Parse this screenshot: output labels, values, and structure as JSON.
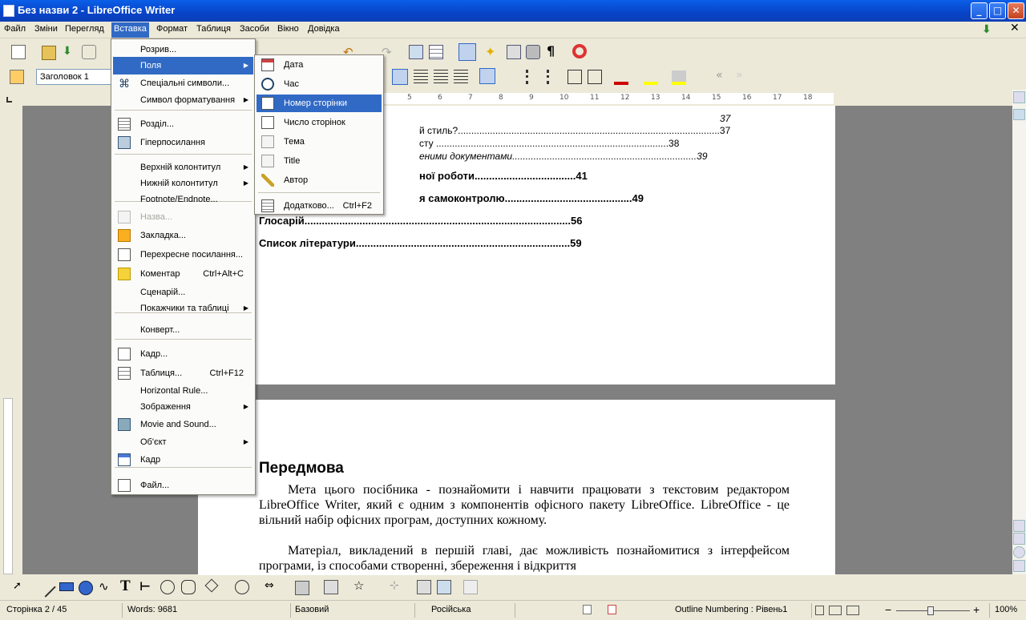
{
  "window": {
    "title": "Без назви 2 - LibreOffice Writer"
  },
  "menubar": {
    "items": [
      "Файл",
      "Зміни",
      "Перегляд",
      "Вставка",
      "Формат",
      "Таблиця",
      "Засоби",
      "Вікно",
      "Довідка"
    ],
    "active": "Вставка"
  },
  "toolbar": {
    "paragraph_style": "Заголовок 1"
  },
  "ruler": {
    "marks": [
      "5",
      "6",
      "7",
      "8",
      "9",
      "10",
      "11",
      "12",
      "13",
      "14",
      "15",
      "16",
      "17",
      "18"
    ]
  },
  "document": {
    "toc_lines": [
      {
        "text": "37",
        "style": "italic"
      },
      {
        "text": "й стиль?..................................................................................................37",
        "style": "normal"
      },
      {
        "text": "сту .......................................................................................38",
        "style": "normal"
      },
      {
        "text": "еними документами.....................................................................39",
        "style": "italic"
      },
      {
        "text": "ної роботи...................................41",
        "style": "bold"
      },
      {
        "text": "я самоконтролю............................................49",
        "style": "bold"
      },
      {
        "text": "Глосарій............................................................................................56",
        "style": "bold"
      },
      {
        "text": "Список літератури..........................................................................59",
        "style": "bold"
      }
    ],
    "heading": "Передмова",
    "paragraph1": "Мета цього посібника - познайомити і навчити працювати з текстовим редактором LibreOffice Writer, який є одним з компонентів офісного пакету LibreOffice. LibreOffice - це вільний набір офісних програм, доступних кожному.",
    "paragraph2": "Матеріал, викладений в першій главі, дає можливість познайомитися з інтерфейсом програми, із способами створенні, збереження і відкриття"
  },
  "insert_menu": {
    "items": [
      {
        "label": "Розрив...",
        "icon": "",
        "submenu": false
      },
      {
        "label": "Поля",
        "icon": "",
        "submenu": true,
        "highlight": true
      },
      {
        "label": "Спеціальні символи...",
        "icon": "special-char-icon",
        "submenu": false
      },
      {
        "label": "Символ форматування",
        "icon": "",
        "submenu": true
      },
      {
        "label": "Розділ...",
        "icon": "section-icon",
        "submenu": false
      },
      {
        "label": "Гіперпосилання",
        "icon": "hyperlink-icon",
        "submenu": false
      },
      {
        "label": "Верхній колонтитул",
        "icon": "",
        "submenu": true
      },
      {
        "label": "Нижній колонтитул",
        "icon": "",
        "submenu": true
      },
      {
        "label": "Footnote/Endnote...",
        "icon": "",
        "submenu": false
      },
      {
        "label": "Назва...",
        "icon": "caption-icon",
        "submenu": false,
        "disabled": true
      },
      {
        "label": "Закладка...",
        "icon": "bookmark-icon",
        "submenu": false
      },
      {
        "label": "Перехресне посилання...",
        "icon": "cross-reference-icon",
        "submenu": false
      },
      {
        "label": "Коментар",
        "icon": "comment-icon",
        "accel": "Ctrl+Alt+C"
      },
      {
        "label": "Сценарій...",
        "icon": "",
        "submenu": false
      },
      {
        "label": "Покажчики та таблиці",
        "icon": "",
        "submenu": true
      },
      {
        "label": "Конверт...",
        "icon": "",
        "submenu": false
      },
      {
        "label": "Кадр...",
        "icon": "frame-icon",
        "submenu": false
      },
      {
        "label": "Таблиця...",
        "icon": "table-icon",
        "accel": "Ctrl+F12"
      },
      {
        "label": "Horizontal Rule...",
        "icon": "",
        "submenu": false
      },
      {
        "label": "Зображення",
        "icon": "",
        "submenu": true
      },
      {
        "label": "Movie and Sound...",
        "icon": "movie-icon",
        "submenu": false
      },
      {
        "label": "Об'єкт",
        "icon": "",
        "submenu": true
      },
      {
        "label": "Кадр",
        "icon": "floating-frame-icon",
        "submenu": false
      },
      {
        "label": "Файл...",
        "icon": "file-icon",
        "submenu": false
      }
    ]
  },
  "fields_submenu": {
    "items": [
      {
        "label": "Дата",
        "icon": "date-icon"
      },
      {
        "label": "Час",
        "icon": "clock-icon"
      },
      {
        "label": "Номер сторінки",
        "icon": "page-number-icon",
        "highlight": true
      },
      {
        "label": "Число сторінок",
        "icon": "page-count-icon"
      },
      {
        "label": "Тема",
        "icon": "subject-icon"
      },
      {
        "label": "Title",
        "icon": "title-icon"
      },
      {
        "label": "Автор",
        "icon": "author-icon"
      },
      {
        "label": "Додатково...",
        "icon": "more-fields-icon",
        "accel": "Ctrl+F2"
      }
    ]
  },
  "statusbar": {
    "page": "Сторінка 2 / 45",
    "words": "Words: 9681",
    "style": "Базовий",
    "language": "Російська",
    "outline": "Outline Numbering : Рівень1",
    "zoom": "100%"
  }
}
